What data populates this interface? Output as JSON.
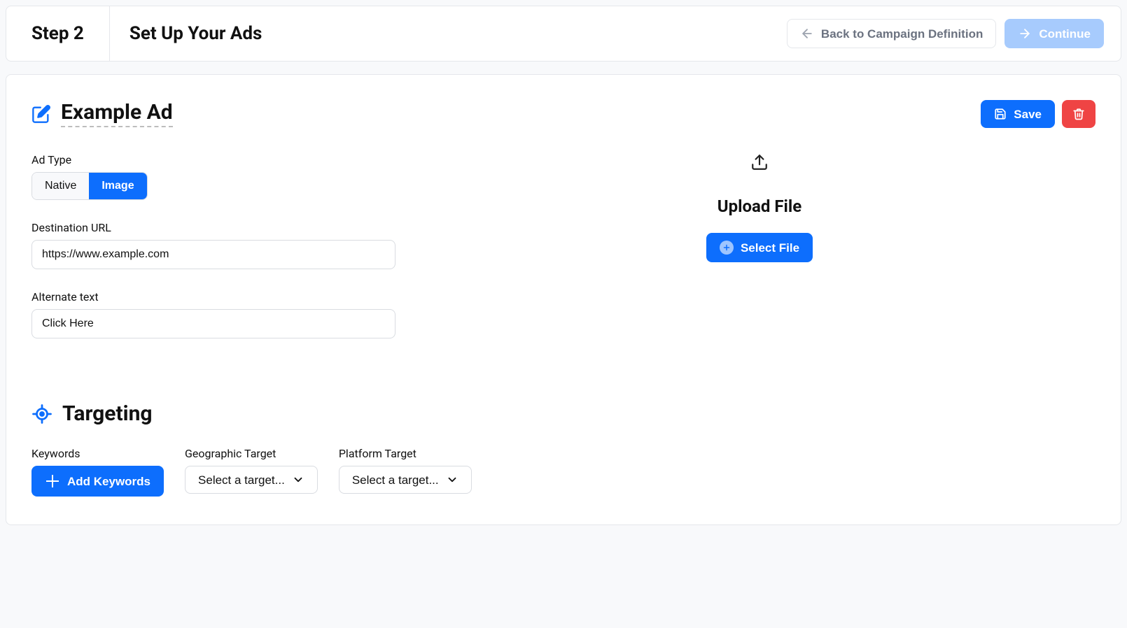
{
  "header": {
    "step_label": "Step 2",
    "title": "Set Up Your Ads",
    "back_label": "Back to Campaign Definition",
    "continue_label": "Continue"
  },
  "ad": {
    "title": "Example Ad",
    "save_label": "Save",
    "ad_type_label": "Ad Type",
    "ad_type_options": {
      "native": "Native",
      "image": "Image"
    },
    "ad_type_selected": "image",
    "destination_label": "Destination URL",
    "destination_value": "https://www.example.com",
    "alt_label": "Alternate text",
    "alt_value": "Click Here",
    "upload_title": "Upload File",
    "select_file_label": "Select File"
  },
  "targeting": {
    "title": "Targeting",
    "keywords_label": "Keywords",
    "add_keywords_label": "Add Keywords",
    "geo_label": "Geographic Target",
    "geo_placeholder": "Select a target...",
    "platform_label": "Platform Target",
    "platform_placeholder": "Select a target..."
  }
}
